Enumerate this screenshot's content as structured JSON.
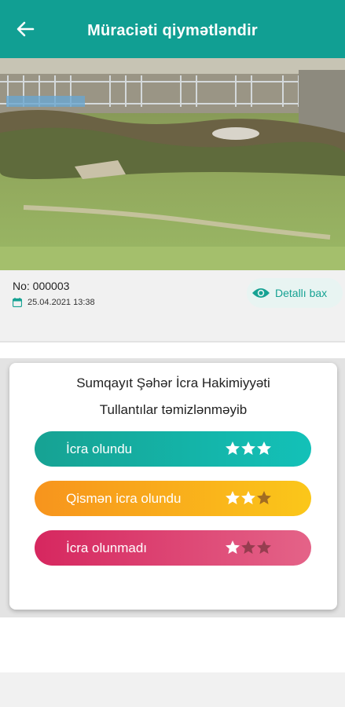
{
  "appbar": {
    "title": "Müraciəti qiymətləndir",
    "back_icon": "arrow-left-icon"
  },
  "info": {
    "number": "No: 000003",
    "date": "25.04.2021 13:38",
    "detail_label": "Detallı bax",
    "detail_icon": "eye-icon",
    "date_icon": "calendar-icon"
  },
  "card": {
    "organization": "Sumqayıt Şəhər İcra Hakimiyyəti",
    "complaint": "Tullantılar təmizlənməyib",
    "options": [
      {
        "label": "İcra olundu",
        "stars_filled": 3,
        "stars_total": 3,
        "color": "#16a293"
      },
      {
        "label": "Qismən icra olundu",
        "stars_filled": 2,
        "stars_total": 3,
        "color": "#f7941d"
      },
      {
        "label": "İcra olunmadı",
        "stars_filled": 1,
        "stars_total": 3,
        "color": "#d6275f"
      }
    ]
  },
  "colors": {
    "primary": "#119f93",
    "accent_text": "#16a293"
  }
}
